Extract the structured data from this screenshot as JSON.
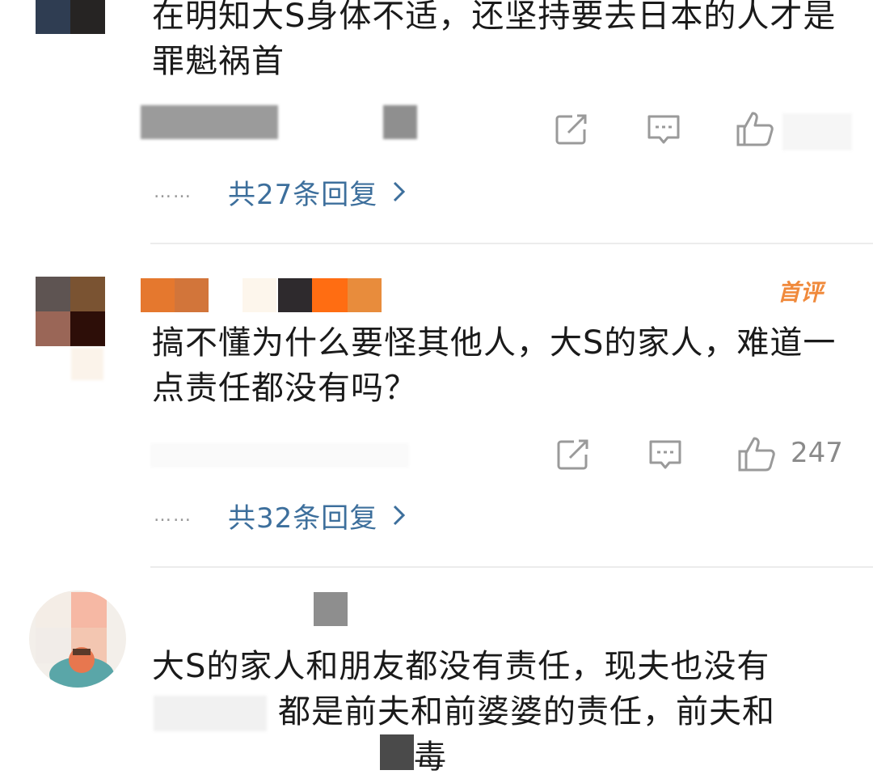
{
  "comments": [
    {
      "text": "在明知大S身体不适，还坚持要去日本的人才是罪魁祸首",
      "replies_label": "共27条回复",
      "reply_dots": "……",
      "like_count": ""
    },
    {
      "badge": "首评",
      "text": "搞不懂为什么要怪其他人，大S的家人，难道一点责任都没有吗？",
      "replies_label": "共32条回复",
      "reply_dots": "……",
      "like_count": "247"
    },
    {
      "text": "大S的家人和朋友都没有责任，现夫也没有",
      "text_line2": "都是前夫和前婆婆的责任，前夫和",
      "text_line3": "毒"
    }
  ],
  "icons": {
    "share": "share-icon",
    "comment": "comment-icon",
    "like": "thumbs-up-icon",
    "more_replies": "chevron-right-icon"
  },
  "colors": {
    "link": "#3d6f9c",
    "badge": "#f08a3c",
    "icon": "#9a9a9a"
  }
}
